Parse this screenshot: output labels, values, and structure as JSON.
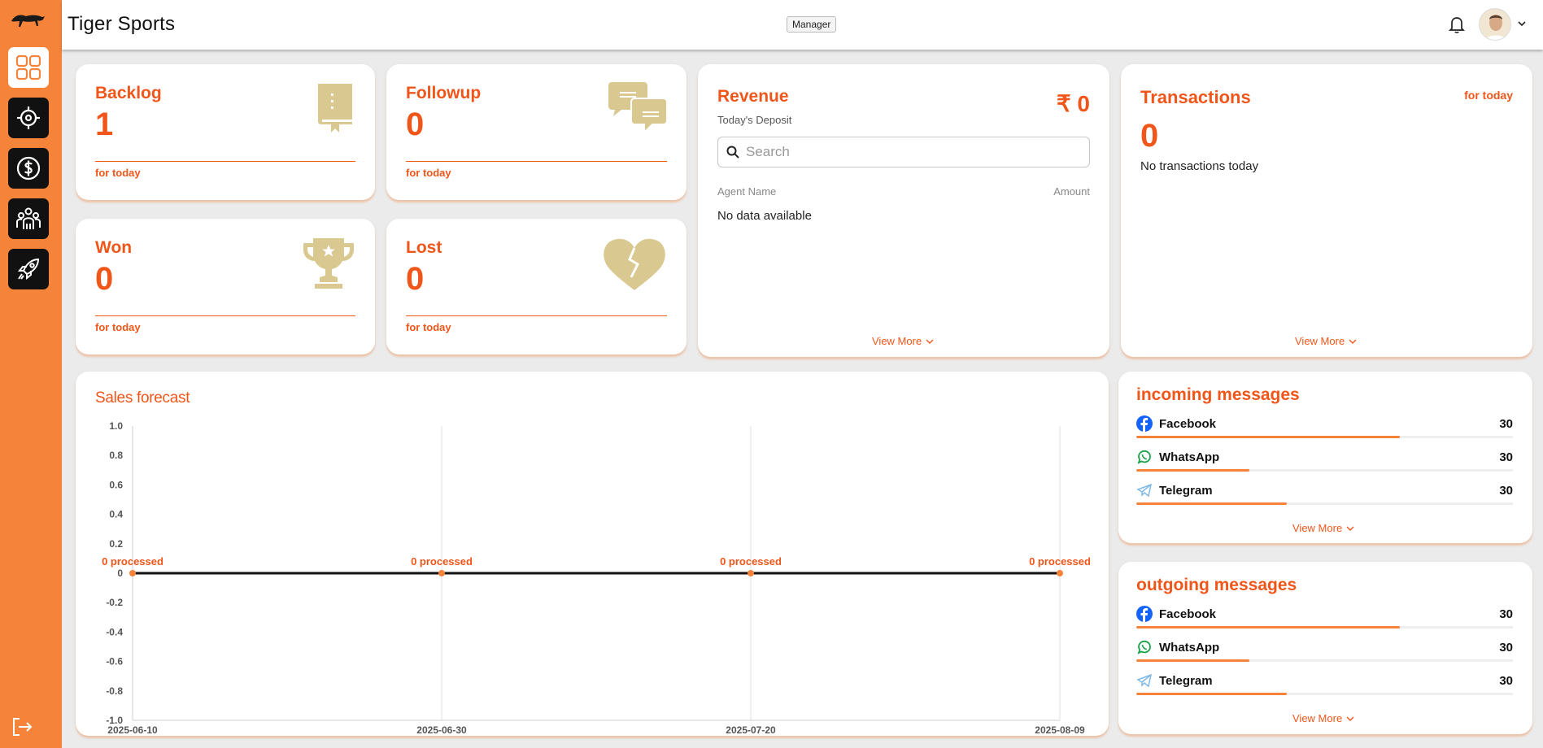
{
  "app": {
    "title": "Tiger Sports",
    "role": "Manager"
  },
  "colors": {
    "accent": "#f0561a",
    "sidebar": "#f5843a",
    "icon_tan": "#d9c88f"
  },
  "sidebar": {
    "items": [
      {
        "name": "dashboard",
        "icon": "grid-icon",
        "active": true
      },
      {
        "name": "targets",
        "icon": "crosshair-icon",
        "active": false
      },
      {
        "name": "revenue",
        "icon": "dollar-icon",
        "active": false
      },
      {
        "name": "team",
        "icon": "people-icon",
        "active": false
      },
      {
        "name": "launch",
        "icon": "rocket-icon",
        "active": false
      }
    ],
    "logout_icon": "logout-icon"
  },
  "stats": {
    "backlog": {
      "title": "Backlog",
      "value": "1",
      "foot": "for today",
      "icon": "book-icon"
    },
    "followup": {
      "title": "Followup",
      "value": "0",
      "foot": "for today",
      "icon": "chat-bubbles-icon"
    },
    "won": {
      "title": "Won",
      "value": "0",
      "foot": "for today",
      "icon": "trophy-icon"
    },
    "lost": {
      "title": "Lost",
      "value": "0",
      "foot": "for today",
      "icon": "broken-heart-icon"
    }
  },
  "revenue": {
    "title": "Revenue",
    "amount": "₹ 0",
    "subtitle": "Today's Deposit",
    "search_placeholder": "Search",
    "col_agent": "Agent Name",
    "col_amount": "Amount",
    "empty": "No data available",
    "view_more": "View More"
  },
  "transactions": {
    "title": "Transactions",
    "period": "for today",
    "value": "0",
    "empty": "No transactions today",
    "view_more": "View More"
  },
  "chart_data": {
    "type": "line",
    "title": "Sales forecast",
    "x": [
      "2025-06-10",
      "2025-06-30",
      "2025-07-20",
      "2025-08-09"
    ],
    "series": [
      {
        "values": [
          0,
          0,
          0,
          0
        ]
      }
    ],
    "data_labels": [
      "0 processed",
      "0 processed",
      "0 processed",
      "0 processed"
    ],
    "ylim": [
      -1.0,
      1.0
    ],
    "yticks": [
      "1.0",
      "0.8",
      "0.6",
      "0.4",
      "0.2",
      "0",
      "-0.2",
      "-0.4",
      "-0.6",
      "-0.8",
      "-1.0"
    ],
    "grid": "vertical",
    "line_color": "#111111",
    "marker_color": "#f5843a",
    "label_color": "#f0561a"
  },
  "incoming": {
    "title": "incoming messages",
    "items": [
      {
        "label": "Facebook",
        "count": "30",
        "icon": "facebook-icon",
        "fill": 0.7
      },
      {
        "label": "WhatsApp",
        "count": "30",
        "icon": "whatsapp-icon",
        "fill": 0.3
      },
      {
        "label": "Telegram",
        "count": "30",
        "icon": "telegram-icon",
        "fill": 0.4
      }
    ],
    "view_more": "View More"
  },
  "outgoing": {
    "title": "outgoing messages",
    "items": [
      {
        "label": "Facebook",
        "count": "30",
        "icon": "facebook-icon",
        "fill": 0.7
      },
      {
        "label": "WhatsApp",
        "count": "30",
        "icon": "whatsapp-icon",
        "fill": 0.3
      },
      {
        "label": "Telegram",
        "count": "30",
        "icon": "telegram-icon",
        "fill": 0.4
      }
    ],
    "view_more": "View More"
  }
}
